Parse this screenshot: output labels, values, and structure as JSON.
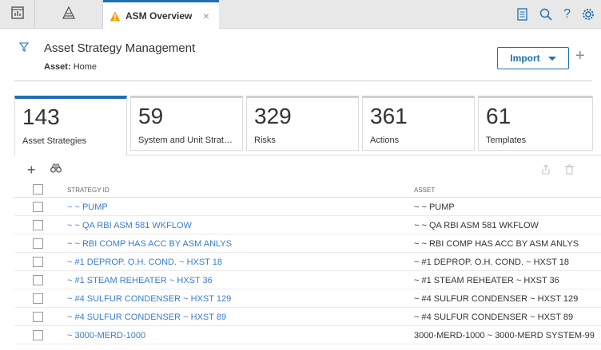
{
  "tabs": {
    "active_title": "ASM Overview",
    "close_glyph": "×"
  },
  "header": {
    "title": "Asset Strategy Management",
    "asset_label": "Asset:",
    "asset_value": "Home",
    "import_label": "Import",
    "add_glyph": "+"
  },
  "cards": [
    {
      "count": "143",
      "label": "Asset Strategies"
    },
    {
      "count": "59",
      "label": "System and Unit Strategi..."
    },
    {
      "count": "329",
      "label": "Risks"
    },
    {
      "count": "361",
      "label": "Actions"
    },
    {
      "count": "61",
      "label": "Templates"
    }
  ],
  "grid": {
    "add_glyph": "+",
    "columns": {
      "strategy_id": "STRATEGY ID",
      "asset": "ASSET"
    },
    "rows": [
      {
        "strategy_id": "~ ~ PUMP",
        "asset": "~ ~ PUMP"
      },
      {
        "strategy_id": "~ ~ QA RBI ASM 581 WKFLOW",
        "asset": "~ ~ QA RBI ASM 581 WKFLOW"
      },
      {
        "strategy_id": "~ ~ RBI COMP HAS ACC BY ASM ANLYS",
        "asset": "~ ~ RBI COMP HAS ACC BY ASM ANLYS"
      },
      {
        "strategy_id": "~ #1 DEPROP. O.H. COND. ~ HXST 18",
        "asset": "~ #1 DEPROP. O.H. COND. ~ HXST 18"
      },
      {
        "strategy_id": "~ #1 STEAM REHEATER ~ HXST 36",
        "asset": "~ #1 STEAM REHEATER ~ HXST 36"
      },
      {
        "strategy_id": "~ #4 SULFUR CONDENSER ~ HXST 129",
        "asset": "~ #4 SULFUR CONDENSER ~ HXST 129"
      },
      {
        "strategy_id": "~ #4 SULFUR CONDENSER ~ HXST 89",
        "asset": "~ #4 SULFUR CONDENSER ~ HXST 89"
      },
      {
        "strategy_id": "~ 3000-MERD-1000",
        "asset": "3000-MERD-1000 ~ 3000-MERD SYSTEM-99"
      }
    ]
  },
  "colors": {
    "accent": "#1f6fb2",
    "link": "#3a7dc9",
    "tab_bar": "#e8e8e8"
  },
  "icons": {
    "tab1": "dashboard-icon",
    "tab2": "pyramid-icon",
    "active_tab": "warning-icon",
    "top_right": [
      "notes-icon",
      "search-icon",
      "help-icon",
      "gear-icon"
    ],
    "header": "filter-icon",
    "grid_tools": [
      "binoculars-icon",
      "share-icon",
      "trash-icon"
    ]
  }
}
